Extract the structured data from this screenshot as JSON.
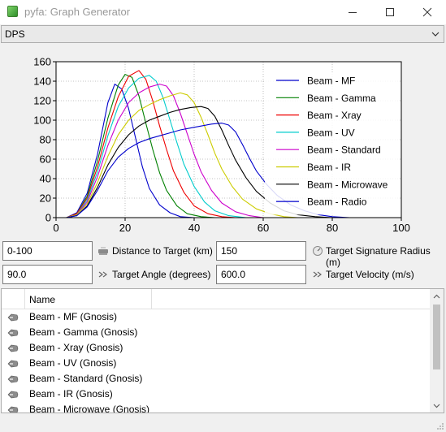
{
  "window": {
    "title": "pyfa: Graph Generator",
    "icon": "pyfa-app-icon"
  },
  "graph_select": {
    "value": "DPS"
  },
  "chart_data": {
    "type": "line",
    "xlim": [
      0,
      100
    ],
    "ylim": [
      0,
      160
    ],
    "x_ticks": [
      "0",
      "20",
      "40",
      "60",
      "80",
      "100"
    ],
    "y_ticks": [
      "0",
      "20",
      "40",
      "60",
      "80",
      "100",
      "120",
      "140",
      "160"
    ],
    "grid": true,
    "legend_position": "right",
    "series": [
      {
        "name": "Beam - MF",
        "color": "#0000cc",
        "points": [
          [
            3,
            0
          ],
          [
            6,
            5
          ],
          [
            9,
            25
          ],
          [
            12,
            65
          ],
          [
            15,
            118
          ],
          [
            17,
            137
          ],
          [
            19,
            132
          ],
          [
            21,
            112
          ],
          [
            23,
            82
          ],
          [
            25,
            52
          ],
          [
            27,
            30
          ],
          [
            30,
            13
          ],
          [
            33,
            5
          ],
          [
            36,
            1
          ],
          [
            40,
            0
          ],
          [
            100,
            0
          ]
        ]
      },
      {
        "name": "Beam - Gamma",
        "color": "#008000",
        "points": [
          [
            3,
            0
          ],
          [
            6,
            4
          ],
          [
            9,
            22
          ],
          [
            12,
            58
          ],
          [
            15,
            102
          ],
          [
            18,
            136
          ],
          [
            20,
            147
          ],
          [
            22,
            144
          ],
          [
            24,
            125
          ],
          [
            26,
            97
          ],
          [
            28,
            70
          ],
          [
            30,
            46
          ],
          [
            32,
            28
          ],
          [
            35,
            12
          ],
          [
            38,
            4
          ],
          [
            42,
            1
          ],
          [
            46,
            0
          ],
          [
            100,
            0
          ]
        ]
      },
      {
        "name": "Beam - Xray",
        "color": "#ee0000",
        "points": [
          [
            3,
            0
          ],
          [
            6,
            4
          ],
          [
            9,
            20
          ],
          [
            12,
            52
          ],
          [
            15,
            92
          ],
          [
            18,
            124
          ],
          [
            21,
            145
          ],
          [
            24,
            151
          ],
          [
            26,
            142
          ],
          [
            28,
            120
          ],
          [
            30,
            94
          ],
          [
            32,
            70
          ],
          [
            34,
            48
          ],
          [
            37,
            26
          ],
          [
            40,
            12
          ],
          [
            44,
            4
          ],
          [
            48,
            1
          ],
          [
            52,
            0
          ],
          [
            100,
            0
          ]
        ]
      },
      {
        "name": "Beam - UV",
        "color": "#00cccc",
        "points": [
          [
            3,
            0
          ],
          [
            6,
            3
          ],
          [
            9,
            18
          ],
          [
            12,
            47
          ],
          [
            15,
            84
          ],
          [
            18,
            114
          ],
          [
            21,
            133
          ],
          [
            24,
            143
          ],
          [
            27,
            146
          ],
          [
            29,
            140
          ],
          [
            31,
            123
          ],
          [
            33,
            100
          ],
          [
            35,
            77
          ],
          [
            37,
            55
          ],
          [
            40,
            32
          ],
          [
            43,
            16
          ],
          [
            46,
            7
          ],
          [
            50,
            2
          ],
          [
            55,
            0
          ],
          [
            100,
            0
          ]
        ]
      },
      {
        "name": "Beam - Standard",
        "color": "#cc00cc",
        "points": [
          [
            3,
            0
          ],
          [
            6,
            3
          ],
          [
            9,
            16
          ],
          [
            12,
            42
          ],
          [
            15,
            74
          ],
          [
            18,
            100
          ],
          [
            21,
            118
          ],
          [
            24,
            128
          ],
          [
            27,
            134
          ],
          [
            30,
            137
          ],
          [
            32,
            135
          ],
          [
            34,
            125
          ],
          [
            36,
            107
          ],
          [
            38,
            86
          ],
          [
            40,
            65
          ],
          [
            42,
            47
          ],
          [
            45,
            28
          ],
          [
            48,
            15
          ],
          [
            52,
            6
          ],
          [
            56,
            2
          ],
          [
            60,
            0
          ],
          [
            100,
            0
          ]
        ]
      },
      {
        "name": "Beam - IR",
        "color": "#cccc00",
        "points": [
          [
            3,
            0
          ],
          [
            6,
            3
          ],
          [
            9,
            14
          ],
          [
            12,
            36
          ],
          [
            15,
            63
          ],
          [
            18,
            85
          ],
          [
            21,
            100
          ],
          [
            24,
            110
          ],
          [
            27,
            116
          ],
          [
            30,
            121
          ],
          [
            33,
            125
          ],
          [
            36,
            128
          ],
          [
            38,
            126
          ],
          [
            40,
            118
          ],
          [
            42,
            103
          ],
          [
            44,
            85
          ],
          [
            46,
            66
          ],
          [
            48,
            50
          ],
          [
            51,
            32
          ],
          [
            54,
            19
          ],
          [
            58,
            9
          ],
          [
            62,
            4
          ],
          [
            66,
            1
          ],
          [
            70,
            0
          ],
          [
            100,
            0
          ]
        ]
      },
      {
        "name": "Beam - Microwave",
        "color": "#000000",
        "points": [
          [
            3,
            0
          ],
          [
            6,
            2
          ],
          [
            9,
            12
          ],
          [
            12,
            31
          ],
          [
            15,
            54
          ],
          [
            18,
            72
          ],
          [
            21,
            85
          ],
          [
            24,
            94
          ],
          [
            27,
            100
          ],
          [
            30,
            104
          ],
          [
            33,
            108
          ],
          [
            36,
            111
          ],
          [
            39,
            113
          ],
          [
            42,
            114
          ],
          [
            44,
            112
          ],
          [
            46,
            104
          ],
          [
            48,
            90
          ],
          [
            50,
            74
          ],
          [
            52,
            59
          ],
          [
            55,
            41
          ],
          [
            58,
            27
          ],
          [
            62,
            15
          ],
          [
            66,
            7
          ],
          [
            70,
            3
          ],
          [
            75,
            1
          ],
          [
            80,
            0
          ],
          [
            100,
            0
          ]
        ]
      },
      {
        "name": "Beam - Radio",
        "color": "#0000cc",
        "points": [
          [
            3,
            0
          ],
          [
            6,
            2
          ],
          [
            9,
            11
          ],
          [
            12,
            28
          ],
          [
            15,
            48
          ],
          [
            18,
            62
          ],
          [
            21,
            71
          ],
          [
            24,
            77
          ],
          [
            27,
            81
          ],
          [
            30,
            84
          ],
          [
            33,
            87
          ],
          [
            36,
            90
          ],
          [
            39,
            92
          ],
          [
            42,
            94
          ],
          [
            45,
            96
          ],
          [
            48,
            97
          ],
          [
            50,
            95
          ],
          [
            52,
            88
          ],
          [
            54,
            75
          ],
          [
            56,
            61
          ],
          [
            58,
            48
          ],
          [
            61,
            34
          ],
          [
            64,
            23
          ],
          [
            68,
            13
          ],
          [
            72,
            7
          ],
          [
            76,
            3
          ],
          [
            80,
            1
          ],
          [
            85,
            0
          ],
          [
            100,
            0
          ]
        ]
      }
    ]
  },
  "fields": {
    "distance": {
      "value": "0-100",
      "label": "Distance to Target (km)"
    },
    "sig_radius": {
      "value": "150",
      "label": "Target Signature Radius (m)"
    },
    "angle": {
      "value": "90.0",
      "label": "Target Angle (degrees)"
    },
    "velocity": {
      "value": "600.0",
      "label": "Target Velocity (m/s)"
    }
  },
  "fit_list": {
    "column_header": "Name",
    "items": [
      "Beam - MF (Gnosis)",
      "Beam - Gamma (Gnosis)",
      "Beam - Xray (Gnosis)",
      "Beam - UV (Gnosis)",
      "Beam - Standard (Gnosis)",
      "Beam - IR (Gnosis)",
      "Beam - Microwave (Gnosis)"
    ]
  }
}
